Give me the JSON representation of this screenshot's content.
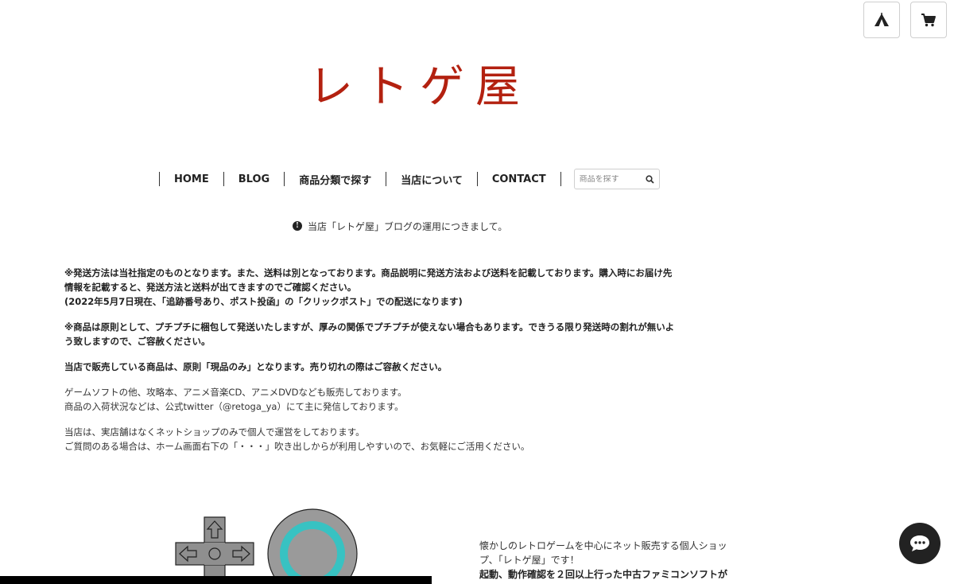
{
  "header": {
    "logo_text": "レトゲ屋",
    "buttons": [
      {
        "icon": "tent-icon"
      },
      {
        "icon": "cart-icon"
      }
    ]
  },
  "nav": {
    "items": [
      "HOME",
      "BLOG",
      "商品分類で探す",
      "当店について",
      "CONTACT"
    ],
    "search_placeholder": "商品を探す"
  },
  "notice": {
    "icon": "info-icon",
    "text": "当店「レトゲ屋」ブログの運用につきまして。"
  },
  "content": {
    "shipping_line1": "※発送方法は当社指定のものとなります。また、送料は別となっております。商品説明に発送方法および送料を記載しております。購入時にお届け先",
    "shipping_line2": "情報を記載すると、発送方法と送料が出てきますのでご確認ください。",
    "shipping_line3": "(2022年5月7日現在、「追跡番号あり、ポスト投函」の「クリックポスト」での配送になります)",
    "packing_line1": "※商品は原則として、プチプチに梱包して発送いたしますが、厚みの関係でプチプチが使えない場合もあります。できうる限り発送時の割れが無いよ",
    "packing_line2": "う致しますので、ご容赦ください。",
    "stock_line": "当店で販売している商品は、原則「現品のみ」となります。売り切れの際はご容赦ください。",
    "products_line1": "ゲームソフトの他、攻略本、アニメ音楽CD、アニメDVDなども販売しております。",
    "products_line2": "商品の入荷状況などは、公式twitter（@retoga_ya）にて主に発信しております。",
    "shop_line1": "当店は、実店舗はなくネットショップのみで個人で運営をしております。",
    "shop_line2": "ご質問のある場合は、ホーム画面右下の「・・・」吹き出しからが利用しやすいので、お気軽にご活用ください。"
  },
  "about": {
    "line1": "懐かしのレトロゲームを中心にネット販売する個人ショッ",
    "line2": "プ、「レトゲ屋」です！",
    "line3": "起動、動作確認を２回以上行った中古ファミコンソフトが"
  },
  "chat": {
    "icon": "chat-bubble-icon"
  },
  "colors": {
    "logo": "#b32110",
    "accent_teal": "#38c2c2",
    "illustration_gray": "#9a9a9a"
  }
}
